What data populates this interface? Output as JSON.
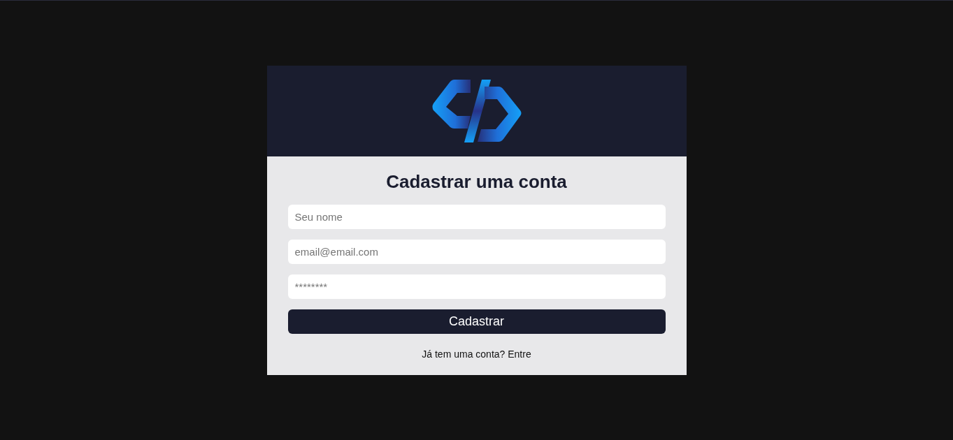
{
  "form": {
    "title": "Cadastrar uma conta",
    "fields": [
      {
        "placeholder": "Seu nome"
      },
      {
        "placeholder": "email@email.com"
      },
      {
        "placeholder": "********"
      }
    ],
    "submit_button": "Cadastrar"
  },
  "footer": {
    "prompt": "Já tem uma conta?",
    "link": "Entre"
  }
}
